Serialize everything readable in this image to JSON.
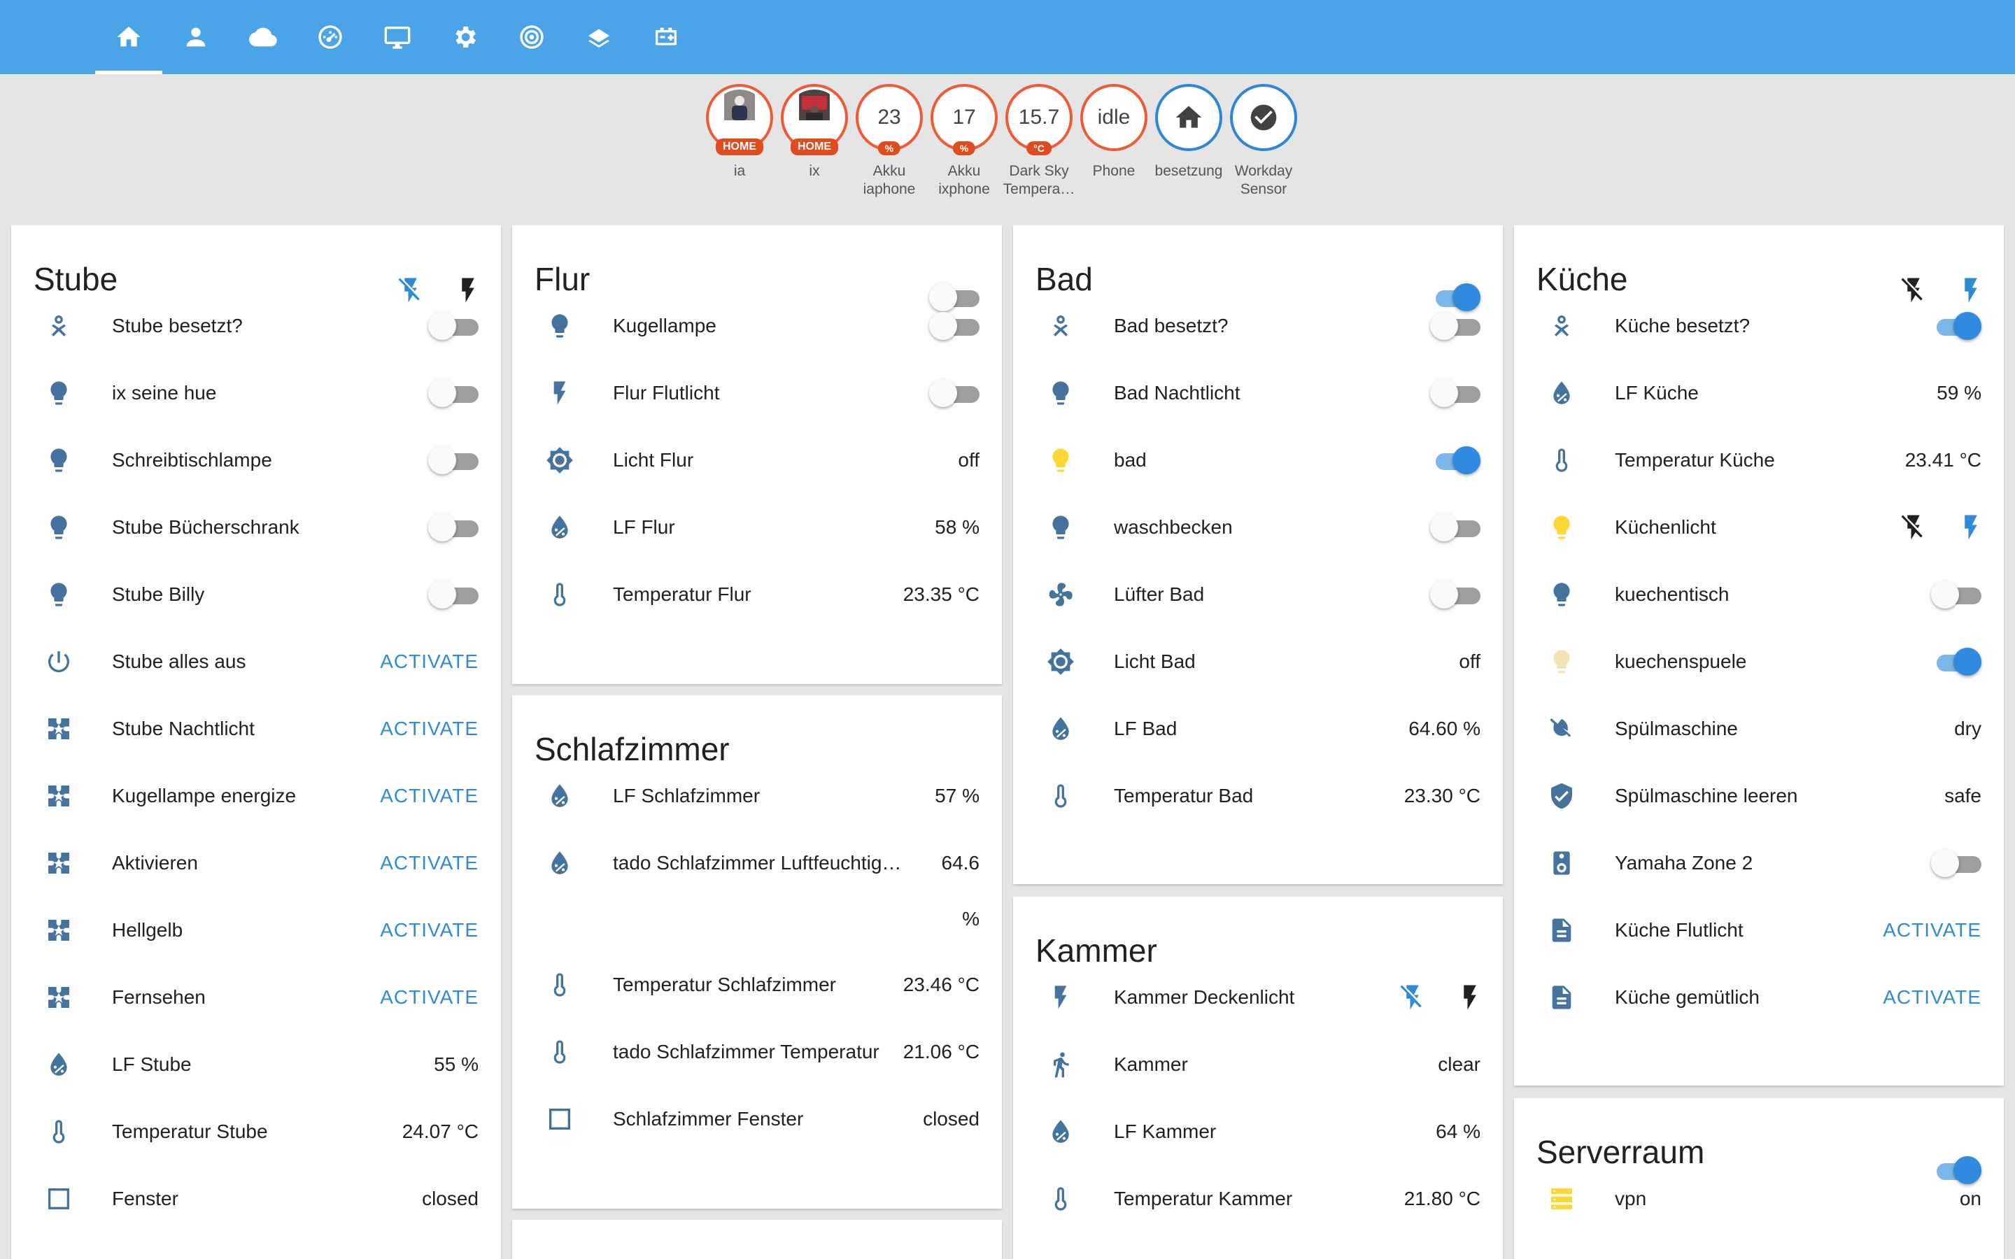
{
  "tabs": [
    {
      "name": "home-icon",
      "active": true
    },
    {
      "name": "person-icon"
    },
    {
      "name": "cloud-icon"
    },
    {
      "name": "gauge-icon"
    },
    {
      "name": "monitor-icon"
    },
    {
      "name": "gear-icon"
    },
    {
      "name": "target-icon"
    },
    {
      "name": "layers-icon"
    },
    {
      "name": "battery-charging-icon"
    }
  ],
  "badges": [
    {
      "label": "ia",
      "tag": "HOME",
      "kind": "picture"
    },
    {
      "label": "ix",
      "tag": "HOME",
      "kind": "picture"
    },
    {
      "label": "Akku\niaphone",
      "value": "23",
      "tag": "%"
    },
    {
      "label": "Akku\nixphone",
      "value": "17",
      "tag": "%"
    },
    {
      "label": "Dark Sky\nTempera…",
      "value": "15.7",
      "tag": "°C"
    },
    {
      "label": "Phone",
      "value": "idle"
    },
    {
      "label": "besetzung",
      "icon": "home-icon"
    },
    {
      "label": "Workday\nSensor",
      "icon": "check-circle-icon"
    }
  ],
  "cards": {
    "stube": {
      "title": "Stube",
      "rows": [
        {
          "name": "Stube besetzt?",
          "icon": "occupancy-icon",
          "toggle": false
        },
        {
          "name": "ix seine hue",
          "icon": "bulb-icon",
          "toggle": false
        },
        {
          "name": "Schreibtischlampe",
          "icon": "bulb-icon",
          "toggle": false
        },
        {
          "name": "Stube Bücherschrank",
          "icon": "bulb-icon",
          "toggle": false
        },
        {
          "name": "Stube Billy",
          "icon": "bulb-icon",
          "toggle": false
        },
        {
          "name": "Stube alles aus",
          "icon": "power-icon",
          "action": "ACTIVATE"
        },
        {
          "name": "Stube Nachtlicht",
          "icon": "scene-icon",
          "action": "ACTIVATE"
        },
        {
          "name": "Kugellampe energize",
          "icon": "scene-icon",
          "action": "ACTIVATE"
        },
        {
          "name": "Aktivieren",
          "icon": "scene-icon",
          "action": "ACTIVATE"
        },
        {
          "name": "Hellgelb",
          "icon": "scene-icon",
          "action": "ACTIVATE"
        },
        {
          "name": "Fernsehen",
          "icon": "scene-icon",
          "action": "ACTIVATE"
        },
        {
          "name": "LF Stube",
          "icon": "humidity-icon",
          "state": "55 %"
        },
        {
          "name": "Temperatur Stube",
          "icon": "thermometer-icon",
          "state": "24.07 °C"
        },
        {
          "name": "Fenster",
          "icon": "window-icon",
          "state": "closed"
        }
      ]
    },
    "flur": {
      "title": "Flur",
      "rows": [
        {
          "name": "Kugellampe",
          "icon": "bulb-icon",
          "toggle": false
        },
        {
          "name": "Flur Flutlicht",
          "icon": "flash-icon",
          "toggle": false
        },
        {
          "name": "Licht Flur",
          "icon": "brightness-icon",
          "state": "off"
        },
        {
          "name": "LF Flur",
          "icon": "humidity-icon",
          "state": "58 %"
        },
        {
          "name": "Temperatur Flur",
          "icon": "thermometer-icon",
          "state": "23.35 °C"
        }
      ]
    },
    "schlafzimmer": {
      "title": "Schlafzimmer",
      "rows": [
        {
          "name": "LF Schlafzimmer",
          "icon": "humidity-icon",
          "state": "57 %"
        },
        {
          "name": "tado Schlafzimmer Luftfeuchtig…",
          "icon": "humidity-icon",
          "state": "64.6",
          "state2": "%"
        },
        {
          "name": "Temperatur Schlafzimmer",
          "icon": "thermometer-icon",
          "state": "23.46 °C"
        },
        {
          "name": "tado Schlafzimmer Temperatur",
          "icon": "thermometer-icon",
          "state": "21.06 °C"
        },
        {
          "name": "Schlafzimmer Fenster",
          "icon": "window-icon",
          "state": "closed"
        }
      ]
    },
    "bad": {
      "title": "Bad",
      "rows": [
        {
          "name": "Bad besetzt?",
          "icon": "occupancy-icon",
          "toggle": false
        },
        {
          "name": "Bad Nachtlicht",
          "icon": "bulb-icon",
          "toggle": false
        },
        {
          "name": "bad",
          "icon": "bulb-icon",
          "toggle": true,
          "color": "#fdd835"
        },
        {
          "name": "waschbecken",
          "icon": "bulb-icon",
          "toggle": false
        },
        {
          "name": "Lüfter Bad",
          "icon": "fan-icon",
          "toggle": false
        },
        {
          "name": "Licht Bad",
          "icon": "brightness-icon",
          "state": "off"
        },
        {
          "name": "LF Bad",
          "icon": "humidity-icon",
          "state": "64.60 %"
        },
        {
          "name": "Temperatur Bad",
          "icon": "thermometer-icon",
          "state": "23.30 °C"
        }
      ]
    },
    "kammer": {
      "title": "Kammer",
      "rows": [
        {
          "name": "Kammer Deckenlicht",
          "icon": "flash-icon",
          "pair": true
        },
        {
          "name": "Kammer",
          "icon": "walk-icon",
          "state": "clear"
        },
        {
          "name": "LF Kammer",
          "icon": "humidity-icon",
          "state": "64 %"
        },
        {
          "name": "Temperatur Kammer",
          "icon": "thermometer-icon",
          "state": "21.80 °C"
        }
      ]
    },
    "kueche": {
      "title": "Küche",
      "rows": [
        {
          "name": "Küche besetzt?",
          "icon": "occupancy-icon",
          "toggle": true
        },
        {
          "name": "LF Küche",
          "icon": "humidity-icon",
          "state": "59 %"
        },
        {
          "name": "Temperatur Küche",
          "icon": "thermometer-icon",
          "state": "23.41 °C"
        },
        {
          "name": "Küchenlicht",
          "icon": "bulb-icon",
          "pair": true,
          "color": "#fdd835"
        },
        {
          "name": "kuechentisch",
          "icon": "bulb-icon",
          "toggle": false
        },
        {
          "name": "kuechenspuele",
          "icon": "bulb-icon",
          "toggle": true,
          "color": "#f3e2b3"
        },
        {
          "name": "Spülmaschine",
          "icon": "water-off-icon",
          "state": "dry"
        },
        {
          "name": "Spülmaschine leeren",
          "icon": "shield-check-icon",
          "state": "safe"
        },
        {
          "name": "Yamaha Zone 2",
          "icon": "speaker-icon",
          "toggle": false
        },
        {
          "name": "Küche Flutlicht",
          "icon": "script-icon",
          "action": "ACTIVATE"
        },
        {
          "name": "Küche gemütlich",
          "icon": "script-icon",
          "action": "ACTIVATE"
        }
      ]
    },
    "serverraum": {
      "title": "Serverraum",
      "rows": [
        {
          "name": "vpn",
          "icon": "server-icon",
          "state": "on",
          "color": "#fdd835"
        }
      ]
    }
  },
  "colors": {
    "topbar": "#4ba3e8",
    "icon": "#44739e",
    "accent": "#2f8ad8",
    "badge_border": "#ef5b37"
  }
}
